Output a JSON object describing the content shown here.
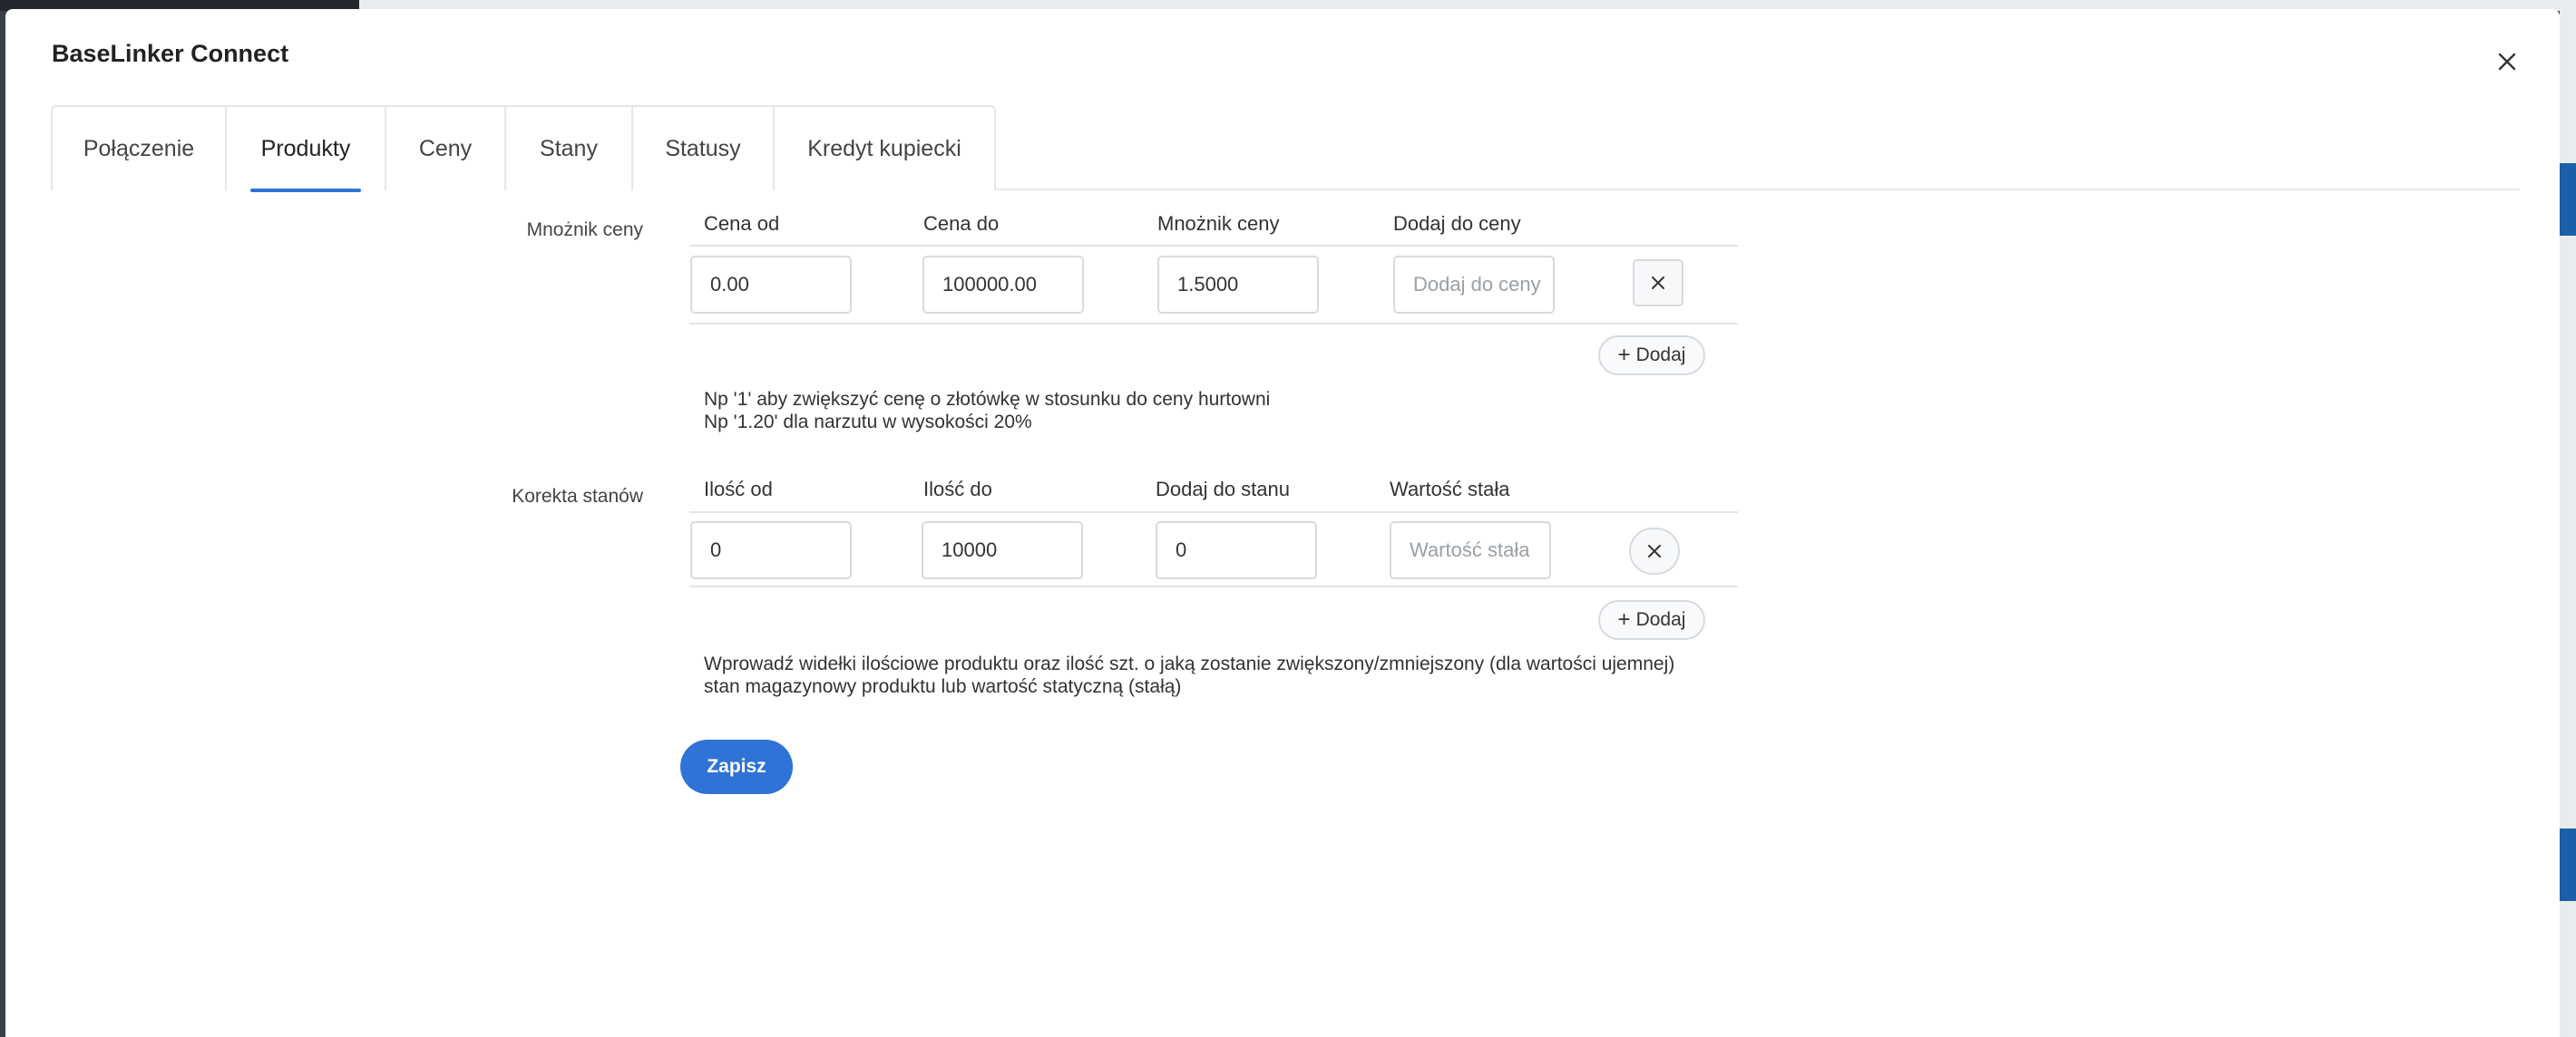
{
  "modal": {
    "title": "BaseLinker Connect"
  },
  "tabs": [
    {
      "label": "Połączenie"
    },
    {
      "label": "Produkty"
    },
    {
      "label": "Ceny"
    },
    {
      "label": "Stany"
    },
    {
      "label": "Statusy"
    },
    {
      "label": "Kredyt kupiecki"
    }
  ],
  "active_tab": "Produkty",
  "price_multiplier": {
    "label": "Mnożnik ceny",
    "columns": [
      "Cena od",
      "Cena do",
      "Mnożnik ceny",
      "Dodaj do ceny"
    ],
    "row": {
      "price_from": "0.00",
      "price_to": "100000.00",
      "multiplier": "1.5000",
      "add_placeholder": "Dodaj do ceny"
    },
    "add_label": "Dodaj",
    "hint_line1": "Np '1' aby zwiększyć cenę o złotówkę w stosunku do ceny hurtowni",
    "hint_line2": "Np '1.20' dla narzutu w wysokości 20%"
  },
  "stock_correction": {
    "label": "Korekta stanów",
    "columns": [
      "Ilość od",
      "Ilość do",
      "Dodaj do stanu",
      "Wartość stała"
    ],
    "row": {
      "qty_from": "0",
      "qty_to": "10000",
      "add_to_stock": "0",
      "fixed_placeholder": "Wartość stała"
    },
    "add_label": "Dodaj",
    "hint_line1": "Wprowadź widełki ilościowe produktu oraz ilość szt. o jaką zostanie zwiększony/zmniejszony (dla wartości ujemnej)",
    "hint_line2": "stan magazynowy produktu lub wartość statyczną (stałą)"
  },
  "save_label": "Zapisz",
  "colors": {
    "accent": "#2f73d6",
    "border": "#d7dade",
    "text": "#333333"
  }
}
